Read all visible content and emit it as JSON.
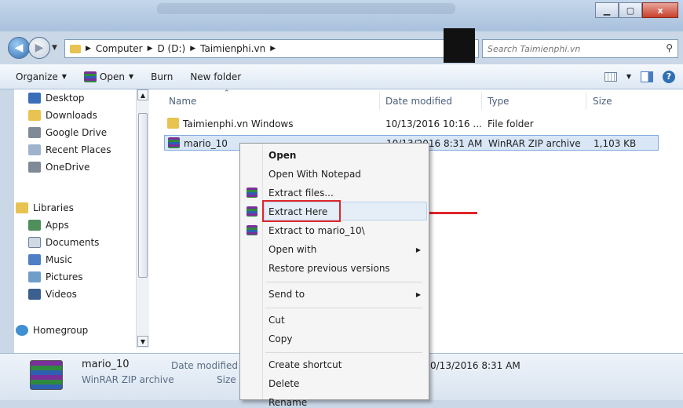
{
  "window": {
    "minimize_icon": "minimize-icon",
    "maximize_icon": "maximize-icon",
    "close_label": "x"
  },
  "address_bar": {
    "crumbs": [
      "Computer",
      "D (D:)",
      "Taimienphi.vn"
    ],
    "separator": "▶"
  },
  "search": {
    "placeholder": "Search Taimienphi.vn"
  },
  "toolbar": {
    "organize_label": "Organize",
    "open_label": "Open",
    "burn_label": "Burn",
    "new_folder_label": "New folder"
  },
  "nav_pane": {
    "favorites": [
      "Desktop",
      "Downloads",
      "Google Drive",
      "Recent Places",
      "OneDrive"
    ],
    "libraries_label": "Libraries",
    "libraries": [
      "Apps",
      "Documents",
      "Music",
      "Pictures",
      "Videos"
    ],
    "homegroup_label": "Homegroup"
  },
  "file_list": {
    "columns": [
      "Name",
      "Date modified",
      "Type",
      "Size"
    ],
    "rows": [
      {
        "name": "Taimienphi.vn Windows",
        "date": "10/13/2016 10:16 ...",
        "type": "File folder",
        "size": "",
        "icon": "folder-icon"
      },
      {
        "name": "mario_10",
        "date": "10/13/2016 8:31 AM",
        "type": "WinRAR ZIP archive",
        "size": "1,103 KB",
        "icon": "winrar-icon"
      }
    ]
  },
  "context_menu": {
    "items": [
      "Open",
      "Open With Notepad",
      "Extract files...",
      "Extract Here",
      "Extract to mario_10\\",
      "Open with",
      "Restore previous versions",
      "Send to",
      "Cut",
      "Copy",
      "Create shortcut",
      "Delete",
      "Rename"
    ],
    "highlighted": "Extract Here"
  },
  "details_pane": {
    "file_name": "mario_10",
    "file_type": "WinRAR ZIP archive",
    "date_label": "Date modified",
    "size_label": "Size",
    "date_value": "0/13/2016 8:31 AM"
  },
  "colors": {
    "highlight_red": "#e0262b",
    "selection_blue": "#d8e6f6"
  }
}
